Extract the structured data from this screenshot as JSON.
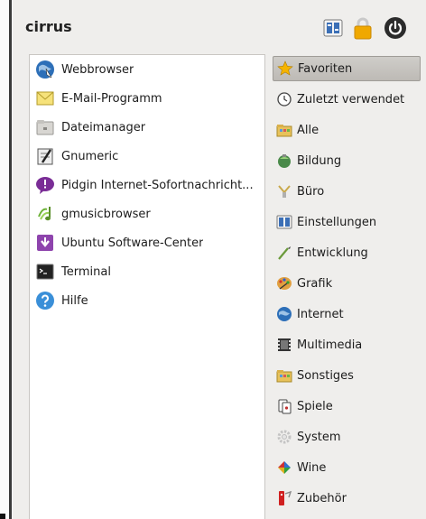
{
  "header": {
    "username": "cirrus"
  },
  "apps": [
    {
      "label": "Webbrowser",
      "icon": "web-browser-icon"
    },
    {
      "label": "E-Mail-Programm",
      "icon": "email-icon"
    },
    {
      "label": "Dateimanager",
      "icon": "folder-icon"
    },
    {
      "label": "Gnumeric",
      "icon": "spreadsheet-icon"
    },
    {
      "label": "Pidgin Internet-Sofortnachricht...",
      "icon": "pidgin-icon"
    },
    {
      "label": "gmusicbrowser",
      "icon": "music-icon"
    },
    {
      "label": "Ubuntu Software-Center",
      "icon": "software-center-icon"
    },
    {
      "label": "Terminal",
      "icon": "terminal-icon"
    },
    {
      "label": "Hilfe",
      "icon": "help-icon"
    }
  ],
  "categories": [
    {
      "label": "Favoriten",
      "icon": "star-icon",
      "selected": true
    },
    {
      "label": "Zuletzt verwendet",
      "icon": "clock-icon"
    },
    {
      "label": "Alle",
      "icon": "folder-icon"
    },
    {
      "label": "Bildung",
      "icon": "education-icon"
    },
    {
      "label": "Büro",
      "icon": "office-icon"
    },
    {
      "label": "Einstellungen",
      "icon": "settings-icon"
    },
    {
      "label": "Entwicklung",
      "icon": "development-icon"
    },
    {
      "label": "Grafik",
      "icon": "graphics-icon"
    },
    {
      "label": "Internet",
      "icon": "internet-icon"
    },
    {
      "label": "Multimedia",
      "icon": "multimedia-icon"
    },
    {
      "label": "Sonstiges",
      "icon": "folder-icon"
    },
    {
      "label": "Spiele",
      "icon": "games-icon"
    },
    {
      "label": "System",
      "icon": "system-gear-icon"
    },
    {
      "label": "Wine",
      "icon": "wine-icon"
    },
    {
      "label": "Zubehör",
      "icon": "accessories-icon"
    }
  ],
  "colors": {
    "accent_star": "#f5b400",
    "lock": "#e8a400",
    "power": "#2b2b2b",
    "selected_bg": "#c7c5c1"
  }
}
